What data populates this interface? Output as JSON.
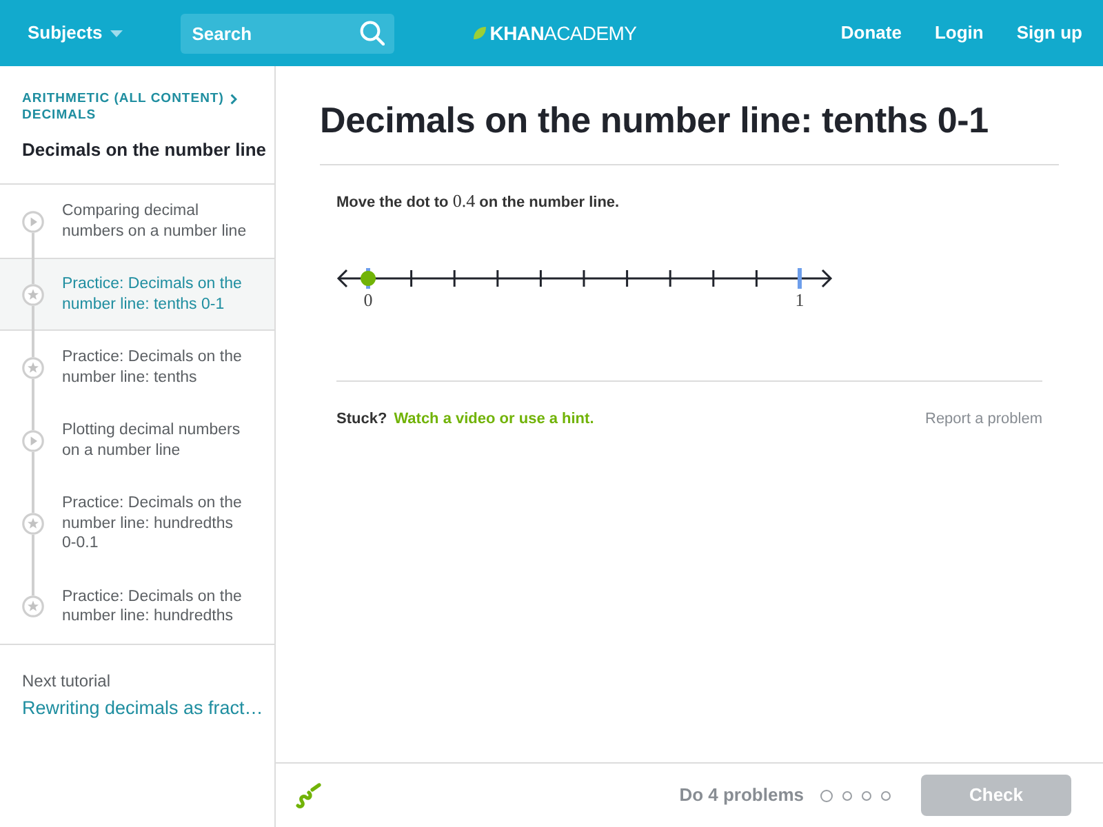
{
  "header": {
    "subjects": "Subjects",
    "search": {
      "placeholder": "Search"
    },
    "logo": "**KHAN**ACADEMY",
    "links": [
      "Donate",
      "Login",
      "Sign up"
    ]
  },
  "sidebar": {
    "breadcrumb": [
      "ARITHMETIC (ALL CONTENT)",
      "DECIMALS"
    ],
    "title": "Decimals on the number line",
    "items": [
      {
        "kind": "video",
        "title": "Comparing decimal numbers on a number line",
        "selected": false
      },
      {
        "kind": "exercise",
        "title": "Practice: Decimals on the number line: tenths 0-1",
        "selected": true
      },
      {
        "kind": "exercise",
        "title": "Practice: Decimals on the number line: tenths",
        "selected": false
      },
      {
        "kind": "video",
        "title": "Plotting decimal numbers on a number line",
        "selected": false
      },
      {
        "kind": "exercise",
        "title": "Practice: Decimals on the number line: hundredths 0-0.1",
        "selected": false
      },
      {
        "kind": "exercise",
        "title": "Practice: Decimals on the number line: hundredths",
        "selected": false
      }
    ],
    "next": {
      "label": "Next tutorial",
      "link": "Rewriting decimals as fract…"
    }
  },
  "exercise": {
    "title": "Decimals on the number line: tenths 0-1",
    "question": {
      "before": "Move the dot to",
      "math": "0.4",
      "after": "on the number line."
    },
    "number_line": {
      "start_label": "0",
      "end_label": "1",
      "level": 0
    },
    "stuck": {
      "label": "Stuck?",
      "link": "Watch a video or use a hint."
    },
    "report": "Report a problem"
  },
  "footer": {
    "task": "Do 4 problems",
    "progress": [
      {
        "current": true
      },
      {
        "current": false
      },
      {
        "current": false
      },
      {
        "current": false
      }
    ],
    "button": {
      "label": "Check",
      "disabled": true
    }
  }
}
